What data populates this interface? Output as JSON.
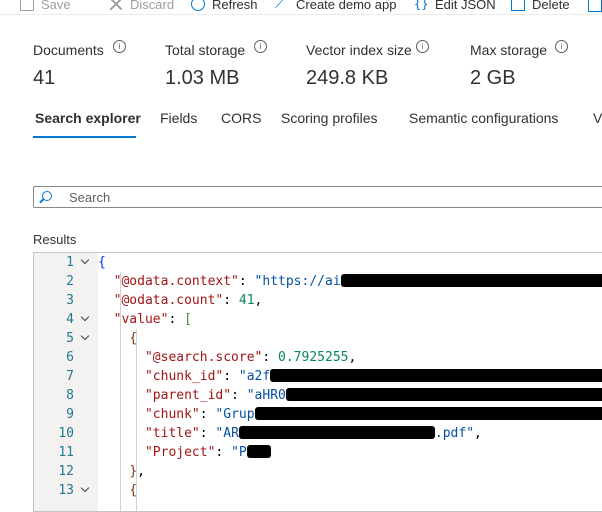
{
  "toolbar": {
    "save": "Save",
    "discard": "Discard",
    "refresh": "Refresh",
    "create_demo_app": "Create demo app",
    "edit_json": "Edit JSON",
    "delete": "Delete"
  },
  "stats": {
    "documents": {
      "label": "Documents",
      "value": "41"
    },
    "total_storage": {
      "label": "Total storage",
      "value": "1.03 MB"
    },
    "vector_index_size": {
      "label": "Vector index size",
      "value": "249.8 KB"
    },
    "max_storage": {
      "label": "Max storage",
      "value": "2 GB"
    }
  },
  "tabs": [
    "Search explorer",
    "Fields",
    "CORS",
    "Scoring profiles",
    "Semantic configurations",
    "V"
  ],
  "active_tab": "Search explorer",
  "search": {
    "placeholder": "Search",
    "value": ""
  },
  "results": {
    "label": "Results",
    "lines": [
      {
        "n": "1",
        "fold": true
      },
      {
        "n": "2",
        "key": "\"@odata.context\"",
        "val": "\"https://ai",
        "redacted": true
      },
      {
        "n": "3",
        "key": "\"@odata.count\"",
        "num": "41"
      },
      {
        "n": "4",
        "key": "\"value\"",
        "fold": true
      },
      {
        "n": "5",
        "fold": true
      },
      {
        "n": "6",
        "key": "\"@search.score\"",
        "num": "0.7925255"
      },
      {
        "n": "7",
        "key": "\"chunk_id\"",
        "val": "\"a2f",
        "redacted": true
      },
      {
        "n": "8",
        "key": "\"parent_id\"",
        "val": "\"aHR0",
        "redacted": true
      },
      {
        "n": "9",
        "key": "\"chunk\"",
        "val": "\"Grup",
        "redacted": true
      },
      {
        "n": "10",
        "key": "\"title\"",
        "val": "\"AR",
        "tail": ".pdf\"",
        "redacted": true
      },
      {
        "n": "11",
        "key": "\"Project\"",
        "val": "\"P",
        "redacted": true
      },
      {
        "n": "12"
      },
      {
        "n": "13",
        "fold": true
      }
    ]
  },
  "colors": {
    "accent": "#0078d4",
    "json_key": "#a31515",
    "json_string": "#0451a5",
    "json_number": "#098658",
    "line_number": "#237893"
  }
}
